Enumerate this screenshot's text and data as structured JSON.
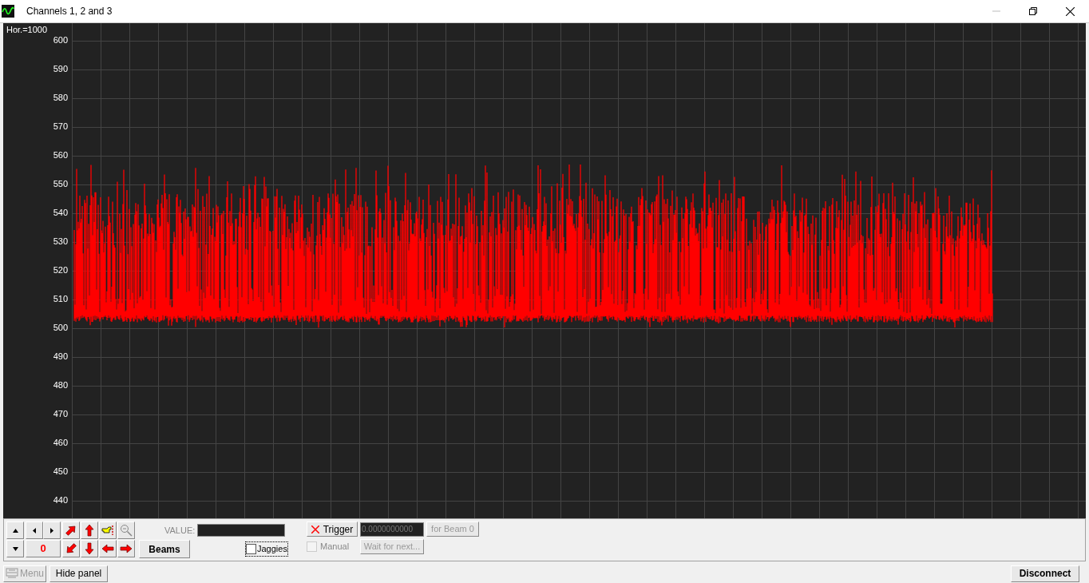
{
  "window": {
    "title": "Channels 1, 2 and 3"
  },
  "chart": {
    "hor_label": "Hor.=1000",
    "y_ticks": [
      "600",
      "590",
      "580",
      "570",
      "560",
      "550",
      "540",
      "530",
      "520",
      "510",
      "500",
      "490",
      "480",
      "470",
      "460",
      "450",
      "440"
    ]
  },
  "panel": {
    "counter": "0",
    "beams_button": "Beams",
    "value_label": "VALUE:",
    "jaggies": {
      "label": "Jaggies",
      "checked": false
    },
    "trigger_button": "Trigger",
    "trigger_value": {
      "value": "0.0000000000",
      "disabled": true
    },
    "for_beam_button": {
      "label": "for Beam 0",
      "disabled": true
    },
    "manual": {
      "label": "Manual",
      "checked": false,
      "disabled": true
    },
    "wait_button": {
      "label": "Wait for next...",
      "disabled": true
    }
  },
  "bottom_bar": {
    "menu_button": {
      "label": "Menu",
      "disabled": true
    },
    "hide_panel_button": "Hide panel",
    "disconnect_button": "Disconnect"
  }
}
